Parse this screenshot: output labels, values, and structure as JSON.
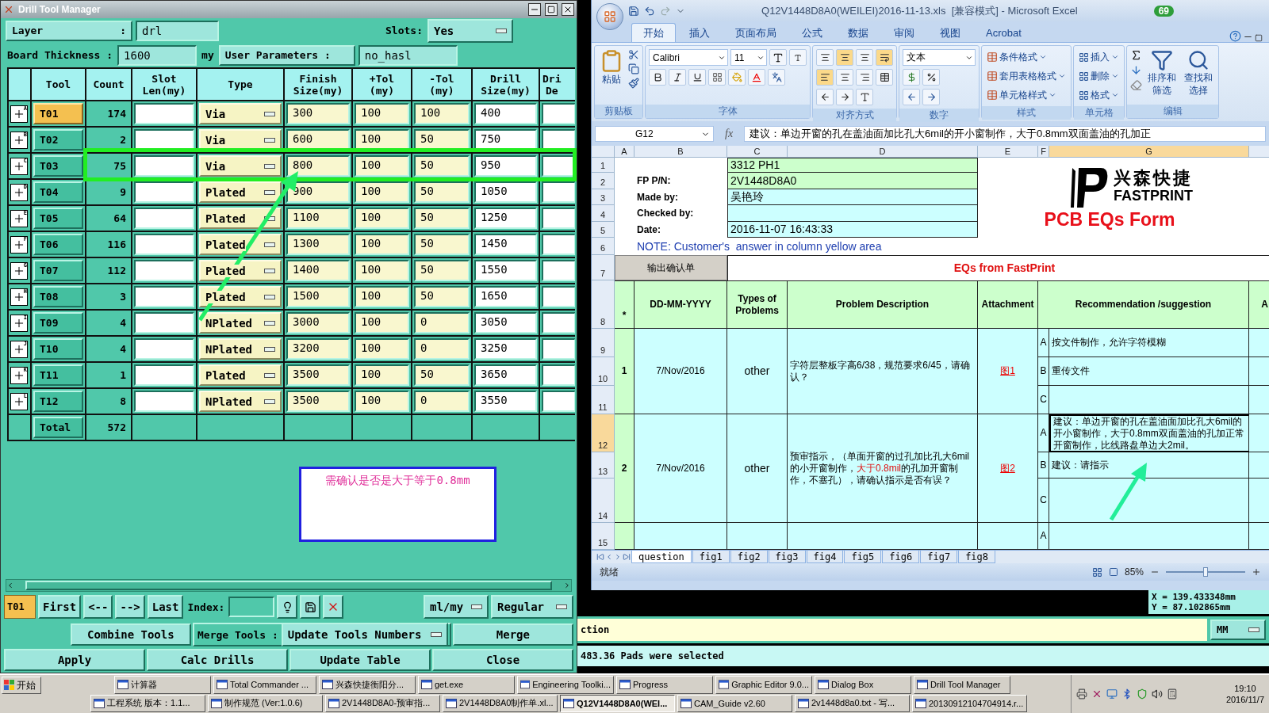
{
  "drill_window": {
    "title": "Drill Tool Manager",
    "layer": {
      "label": "Layer",
      "separator": ":",
      "value": "drl"
    },
    "slots": {
      "label": "Slots:",
      "value": "Yes"
    },
    "board_thickness": {
      "label": "Board Thickness :",
      "value": "1600",
      "unit": "my"
    },
    "user_parameters": {
      "label": "User Parameters :",
      "value": "no_hasl"
    },
    "columns": [
      "Tool",
      "Count",
      "Slot\nLen(my)",
      "Type",
      "Finish\nSize(my)",
      "+Tol\n(my)",
      "-Tol\n(my)",
      "Drill\nSize(my)",
      "Dri\nDe"
    ],
    "rows": [
      {
        "mark": "A",
        "tool": "T01",
        "count": "174",
        "type": "Via",
        "finish": "300",
        "plus_tol": "100",
        "minus_tol": "100",
        "drill": "400",
        "selected": true
      },
      {
        "mark": "B",
        "tool": "T02",
        "count": "2",
        "type": "Via",
        "finish": "600",
        "plus_tol": "100",
        "minus_tol": "50",
        "drill": "750",
        "selected": false
      },
      {
        "mark": "C",
        "tool": "T03",
        "count": "75",
        "type": "Via",
        "finish": "800",
        "plus_tol": "100",
        "minus_tol": "50",
        "drill": "950",
        "selected": false
      },
      {
        "mark": "D",
        "tool": "T04",
        "count": "9",
        "type": "Plated",
        "finish": "900",
        "plus_tol": "100",
        "minus_tol": "50",
        "drill": "1050",
        "selected": false
      },
      {
        "mark": "E",
        "tool": "T05",
        "count": "64",
        "type": "Plated",
        "finish": "1100",
        "plus_tol": "100",
        "minus_tol": "50",
        "drill": "1250",
        "selected": false
      },
      {
        "mark": "F",
        "tool": "T06",
        "count": "116",
        "type": "Plated",
        "finish": "1300",
        "plus_tol": "100",
        "minus_tol": "50",
        "drill": "1450",
        "selected": false
      },
      {
        "mark": "G",
        "tool": "T07",
        "count": "112",
        "type": "Plated",
        "finish": "1400",
        "plus_tol": "100",
        "minus_tol": "50",
        "drill": "1550",
        "selected": false
      },
      {
        "mark": "H",
        "tool": "T08",
        "count": "3",
        "type": "Plated",
        "finish": "1500",
        "plus_tol": "100",
        "minus_tol": "50",
        "drill": "1650",
        "selected": false
      },
      {
        "mark": "I",
        "tool": "T09",
        "count": "4",
        "type": "NPlated",
        "finish": "3000",
        "plus_tol": "100",
        "minus_tol": "0",
        "drill": "3050",
        "selected": false
      },
      {
        "mark": "J",
        "tool": "T10",
        "count": "4",
        "type": "NPlated",
        "finish": "3200",
        "plus_tol": "100",
        "minus_tol": "0",
        "drill": "3250",
        "selected": false
      },
      {
        "mark": "K",
        "tool": "T11",
        "count": "1",
        "type": "Plated",
        "finish": "3500",
        "plus_tol": "100",
        "minus_tol": "50",
        "drill": "3650",
        "selected": false
      },
      {
        "mark": "L",
        "tool": "T12",
        "count": "8",
        "type": "NPlated",
        "finish": "3500",
        "plus_tol": "100",
        "minus_tol": "0",
        "drill": "3550",
        "selected": false
      }
    ],
    "total": {
      "label": "Total",
      "count": "572"
    },
    "note": "需确认是否是大于等于0.8mm",
    "nav": {
      "current": "T01",
      "buttons": [
        "First",
        "<--",
        "-->",
        "Last"
      ],
      "index_label": "Index:",
      "units": "ml/my",
      "mode": "Regular"
    },
    "merge_row": {
      "combine": "Combine Tools",
      "merge_label": "Merge Tools :",
      "merge_option": "Update Tools Numbers",
      "merge": "Merge"
    },
    "actions": [
      "Apply",
      "Calc Drills",
      "Update Table",
      "Close"
    ]
  },
  "excel": {
    "title": "Q12V1448D8A0(WEILEI)2016-11-13.xls  [兼容模式] - Microsoft Excel",
    "badge": "69",
    "tabs": [
      {
        "label": "开始",
        "selected": true
      },
      {
        "label": "插入",
        "selected": false
      },
      {
        "label": "页面布局",
        "selected": false
      },
      {
        "label": "公式",
        "selected": false
      },
      {
        "label": "数据",
        "selected": false
      },
      {
        "label": "审阅",
        "selected": false
      },
      {
        "label": "视图",
        "selected": false
      },
      {
        "label": "Acrobat",
        "selected": false
      }
    ],
    "ribbon": {
      "paste": "粘贴",
      "font": "Calibri",
      "font_size": "11",
      "number_format": "文本",
      "styles": [
        "条件格式",
        "套用表格格式",
        "单元格样式"
      ],
      "cells": [
        "插入",
        "删除",
        "格式"
      ],
      "sort": "排序和筛选",
      "find": "查找和选择",
      "groups": [
        "剪贴板",
        "字体",
        "对齐方式",
        "数字",
        "样式",
        "单元格",
        "编辑"
      ]
    },
    "name_box": "G12",
    "function_label": "fx",
    "formula": "建议：单边开窗的孔在盖油面加比孔大6mil的开小窗制作，大于0.8mm双面盖油的孔加正",
    "column_letters": [
      {
        "label": "A",
        "selected": false
      },
      {
        "label": "B",
        "selected": false
      },
      {
        "label": "C",
        "selected": false
      },
      {
        "label": "D",
        "selected": false
      },
      {
        "label": "E",
        "selected": false
      },
      {
        "label": "F",
        "selected": false
      },
      {
        "label": "G",
        "selected": true
      }
    ],
    "row_numbers": [
      {
        "label": "1",
        "selected": false
      },
      {
        "label": "2",
        "selected": false
      },
      {
        "label": "3",
        "selected": false
      },
      {
        "label": "4",
        "selected": false
      },
      {
        "label": "5",
        "selected": false
      },
      {
        "label": "6",
        "selected": false
      },
      {
        "label": "7",
        "selected": false
      },
      {
        "label": "8",
        "selected": false
      },
      {
        "label": "9",
        "selected": false
      },
      {
        "label": "10",
        "selected": false
      },
      {
        "label": "11",
        "selected": false
      },
      {
        "label": "12",
        "selected": true
      },
      {
        "label": "13",
        "selected": false
      },
      {
        "label": "14",
        "selected": false
      },
      {
        "label": "15",
        "selected": false
      }
    ],
    "info": [
      {
        "value": "3312 PH1",
        "color": "#ccffcc"
      },
      {
        "label": "FP P/N:",
        "value": "2V1448D8A0",
        "color": "#ccffcc"
      },
      {
        "label": "Made by:",
        "value": "吴艳玲",
        "color": "#ccffff"
      },
      {
        "label": "Checked by:",
        "color": "#ccffff"
      },
      {
        "label": "Date:",
        "value": "2016-11-07 16:43:33",
        "color": "#ccffff"
      }
    ],
    "logo": {
      "chinese": "兴森快捷",
      "english": "FASTPRINT",
      "form_title": "PCB EQs Form"
    },
    "note": "NOTE: Customer's  answer in column yellow area",
    "export_button": "输出确认单",
    "eq_title": "EQs from FastPrint",
    "headers": [
      "*",
      "DD-MM-YYYY",
      "Types of Problems",
      "Problem Description",
      "Attachment",
      "Recommendation /suggestion",
      "A"
    ],
    "items": [
      {
        "no": "1",
        "date": "7/Nov/2016",
        "type": "other",
        "problem_parts": [
          {
            "text": "字符层整板字高6/38，规范要求6/45，请确认？",
            "highlight": false
          }
        ],
        "attachment": "图1",
        "options": [
          {
            "letter": "A",
            "text": "按文件制作，允许字符模糊",
            "selected": false
          },
          {
            "letter": "B",
            "text": "重传文件",
            "selected": false
          },
          {
            "letter": "C",
            "selected": false
          }
        ]
      },
      {
        "no": "2",
        "date": "7/Nov/2016",
        "type": "other",
        "problem_parts": [
          {
            "text": "预审指示，（单面开窗的过孔加比孔大6mil的小开窗制作，",
            "highlight": false
          },
          {
            "text": "大于0.8mil",
            "highlight": true
          },
          {
            "text": "的孔加开窗制作，不塞孔），请确认指示是否有误？",
            "highlight": false
          }
        ],
        "attachment": "图2",
        "options": [
          {
            "letter": "A",
            "text": "建议：单边开窗的孔在盖油面加比孔大6mil的开小窗制作，大于0.8mm双面盖油的孔加正常开窗制作，比线路盘单边大2mil。",
            "selected": true
          },
          {
            "letter": "B",
            "text": "建议：请指示",
            "selected": false
          },
          {
            "letter": "C",
            "selected": false
          }
        ]
      },
      {
        "options": [
          {
            "letter": "A",
            "selected": false
          }
        ]
      }
    ],
    "sheets": [
      {
        "label": "question",
        "selected": true
      },
      {
        "label": "fig1",
        "selected": false
      },
      {
        "label": "fig2",
        "selected": false
      },
      {
        "label": "fig3",
        "selected": false
      },
      {
        "label": "fig4",
        "selected": false
      },
      {
        "label": "fig5",
        "selected": false
      },
      {
        "label": "fig6",
        "selected": false
      },
      {
        "label": "fig7",
        "selected": false
      },
      {
        "label": "fig8",
        "selected": false
      }
    ],
    "status": "就绪",
    "zoom": "85%",
    "zoom_slider": {
      "level": 0.5
    }
  },
  "cam": {
    "coord_x": "X = 139.433348mm",
    "coord_y": "Y = 87.102865mm",
    "command": "ction",
    "units": "MM",
    "status": "483.36 Pads were selected"
  },
  "taskbar": {
    "start": "开始",
    "top": [
      {
        "label": "计算器",
        "selected": false
      },
      {
        "label": "Total Commander ...",
        "selected": false
      },
      {
        "label": "兴森快捷衡阳分...",
        "selected": false
      },
      {
        "label": "get.exe",
        "selected": false
      },
      {
        "label": "Engineering Toolki...",
        "selected": false
      },
      {
        "label": "Progress",
        "selected": false
      },
      {
        "label": "Graphic Editor 9.0...",
        "selected": false
      },
      {
        "label": "Dialog Box",
        "selected": false
      },
      {
        "label": "Drill Tool Manager",
        "selected": false
      }
    ],
    "bottom": [
      {
        "label": "工程系统  版本：1.1...",
        "selected": false
      },
      {
        "label": "制作规范 (Ver:1.0.6)",
        "selected": false
      },
      {
        "label": "2V1448D8A0-预审指...",
        "selected": false
      },
      {
        "label": "2V1448D8A0制作单.xl...",
        "selected": false
      },
      {
        "label": "Q12V1448D8A0(WEI...",
        "selected": true
      },
      {
        "label": "CAM_Guide v2.60",
        "selected": false
      },
      {
        "label": "2v1448d8a0.txt - 写...",
        "selected": false
      },
      {
        "label": "20130912104704914.r...",
        "selected": false
      }
    ],
    "time": "19:10",
    "date": "2016/11/7"
  }
}
